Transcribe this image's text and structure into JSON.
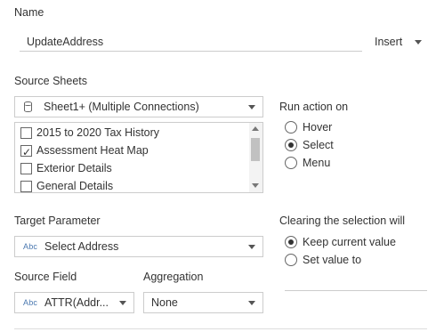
{
  "name_section": {
    "label": "Name",
    "value": "UpdateAddress",
    "insert_label": "Insert"
  },
  "source_sheets": {
    "label": "Source Sheets",
    "selected": "Sheet1+ (Multiple Connections)",
    "sheets": [
      {
        "label": "2015 to 2020 Tax History",
        "checked": false
      },
      {
        "label": "Assessment Heat Map",
        "checked": true
      },
      {
        "label": "Exterior Details",
        "checked": false
      },
      {
        "label": "General Details",
        "checked": false
      }
    ]
  },
  "run_action": {
    "label": "Run action on",
    "options": [
      {
        "label": "Hover",
        "selected": false
      },
      {
        "label": "Select",
        "selected": true
      },
      {
        "label": "Menu",
        "selected": false
      }
    ]
  },
  "target_parameter": {
    "label": "Target Parameter",
    "type_badge": "Abc",
    "value": "Select Address"
  },
  "clearing": {
    "label": "Clearing the selection will",
    "options": [
      {
        "label": "Keep current value",
        "selected": true
      },
      {
        "label": "Set value to",
        "selected": false
      }
    ]
  },
  "source_field": {
    "label": "Source Field",
    "type_badge": "Abc",
    "value": "ATTR(Addr..."
  },
  "aggregation": {
    "label": "Aggregation",
    "value": "None"
  }
}
